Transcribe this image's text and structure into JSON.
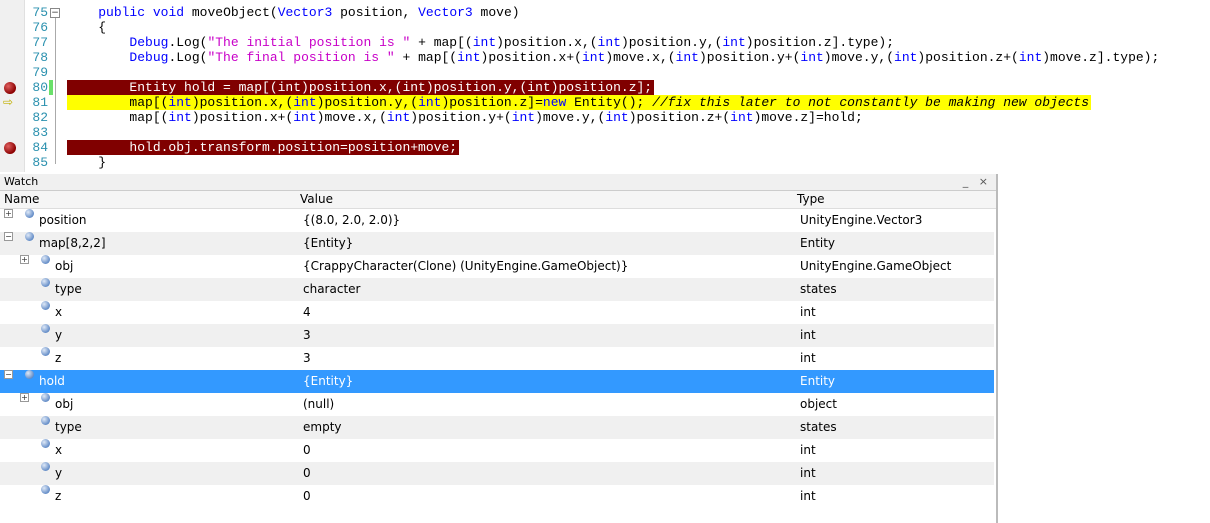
{
  "editor": {
    "lines": [
      {
        "num": "75",
        "tokens": [
          [
            "    ",
            ""
          ],
          [
            "public",
            "k"
          ],
          [
            " ",
            ""
          ],
          [
            "void",
            "k"
          ],
          [
            " moveObject(",
            ""
          ],
          [
            "Vector3",
            "k"
          ],
          [
            " position, ",
            ""
          ],
          [
            "Vector3",
            "k"
          ],
          [
            " move)",
            ""
          ]
        ]
      },
      {
        "num": "76",
        "tokens": [
          [
            "    {",
            ""
          ]
        ]
      },
      {
        "num": "77",
        "tokens": [
          [
            "        ",
            ""
          ],
          [
            "Debug",
            "k"
          ],
          [
            ".Log(",
            ""
          ],
          [
            "\"The initial position is \"",
            "s"
          ],
          [
            " + map[(",
            ""
          ],
          [
            "int",
            "k"
          ],
          [
            ")position.x,(",
            ""
          ],
          [
            "int",
            "k"
          ],
          [
            ")position.y,(",
            ""
          ],
          [
            "int",
            "k"
          ],
          [
            ")position.z].type);",
            ""
          ]
        ]
      },
      {
        "num": "78",
        "tokens": [
          [
            "        ",
            ""
          ],
          [
            "Debug",
            "k"
          ],
          [
            ".Log(",
            ""
          ],
          [
            "\"The final position is \"",
            "s"
          ],
          [
            " + map[(",
            ""
          ],
          [
            "int",
            "k"
          ],
          [
            ")position.x+(",
            ""
          ],
          [
            "int",
            "k"
          ],
          [
            ")move.x,(",
            ""
          ],
          [
            "int",
            "k"
          ],
          [
            ")position.y+(",
            ""
          ],
          [
            "int",
            "k"
          ],
          [
            ")move.y,(",
            ""
          ],
          [
            "int",
            "k"
          ],
          [
            ")position.z+(",
            ""
          ],
          [
            "int",
            "k"
          ],
          [
            ")move.z].type);",
            ""
          ]
        ]
      },
      {
        "num": "79",
        "tokens": []
      },
      {
        "num": "80",
        "highlight": "red",
        "breakpoint": true,
        "tokens": [
          [
            "        Entity hold = map[(int)position.x,(int)position.y,(int)position.z];",
            ""
          ]
        ]
      },
      {
        "num": "81",
        "highlight": "yellow",
        "current": true,
        "tokens": [
          [
            "        map[(",
            ""
          ],
          [
            "int",
            "k"
          ],
          [
            ")position.x,(",
            ""
          ],
          [
            "int",
            "k"
          ],
          [
            ")position.y,(",
            ""
          ],
          [
            "int",
            "k"
          ],
          [
            ")position.z]=",
            ""
          ],
          [
            "new",
            "k"
          ],
          [
            " Entity(); ",
            ""
          ],
          [
            "//fix this later to not constantly be making new objects",
            "c"
          ]
        ]
      },
      {
        "num": "82",
        "tokens": [
          [
            "        map[(",
            ""
          ],
          [
            "int",
            "k"
          ],
          [
            ")position.x+(",
            ""
          ],
          [
            "int",
            "k"
          ],
          [
            ")move.x,(",
            ""
          ],
          [
            "int",
            "k"
          ],
          [
            ")position.y+(",
            ""
          ],
          [
            "int",
            "k"
          ],
          [
            ")move.y,(",
            ""
          ],
          [
            "int",
            "k"
          ],
          [
            ")position.z+(",
            ""
          ],
          [
            "int",
            "k"
          ],
          [
            ")move.z]=hold;",
            ""
          ]
        ]
      },
      {
        "num": "83",
        "tokens": []
      },
      {
        "num": "84",
        "highlight": "red",
        "breakpoint": true,
        "tokens": [
          [
            "        hold.obj.transform.position=position+move;",
            ""
          ]
        ]
      },
      {
        "num": "85",
        "tokens": [
          [
            "    }",
            ""
          ]
        ]
      }
    ]
  },
  "watch": {
    "title": "Watch",
    "minimize": "_",
    "close": "×",
    "columns": {
      "name": "Name",
      "value": "Value",
      "type": "Type"
    },
    "rows": [
      {
        "name": "position",
        "value": "{(8.0, 2.0, 2.0)}",
        "type": "UnityEngine.Vector3",
        "level": 0,
        "expander": "+"
      },
      {
        "name": "map[8,2,2]",
        "value": "{Entity}",
        "type": "Entity",
        "level": 0,
        "expander": "−"
      },
      {
        "name": "obj",
        "value": "{CrappyCharacter(Clone) (UnityEngine.GameObject)}",
        "type": "UnityEngine.GameObject",
        "level": 1,
        "expander": "+"
      },
      {
        "name": "type",
        "value": "character",
        "type": "states",
        "level": 1
      },
      {
        "name": "x",
        "value": "4",
        "type": "int",
        "level": 1
      },
      {
        "name": "y",
        "value": "3",
        "type": "int",
        "level": 1
      },
      {
        "name": "z",
        "value": "3",
        "type": "int",
        "level": 1
      },
      {
        "name": "hold",
        "value": "{Entity}",
        "type": "Entity",
        "level": 0,
        "expander": "−",
        "selected": true
      },
      {
        "name": "obj",
        "value": "(null)",
        "type": "object",
        "level": 1,
        "expander": "+"
      },
      {
        "name": "type",
        "value": "empty",
        "type": "states",
        "level": 1
      },
      {
        "name": "x",
        "value": "0",
        "type": "int",
        "level": 1
      },
      {
        "name": "y",
        "value": "0",
        "type": "int",
        "level": 1
      },
      {
        "name": "z",
        "value": "0",
        "type": "int",
        "level": 1
      }
    ]
  }
}
